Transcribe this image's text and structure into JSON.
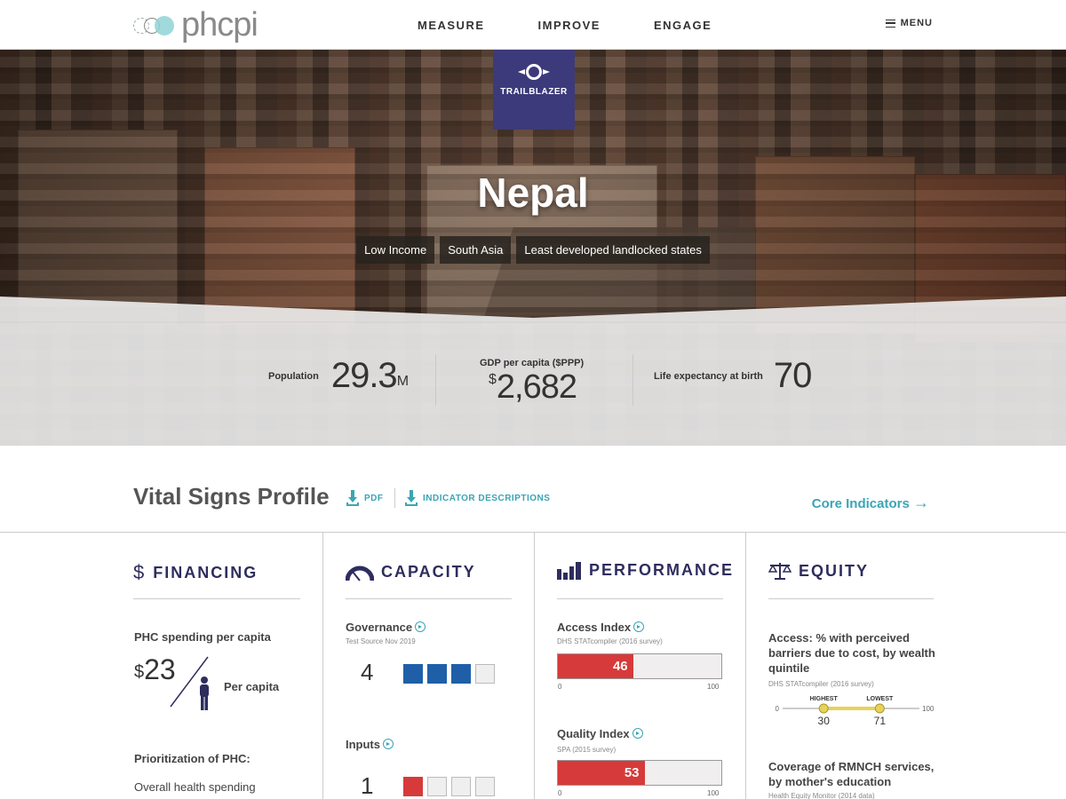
{
  "header": {
    "logo_text": "phcpi",
    "nav": [
      "MEASURE",
      "IMPROVE",
      "ENGAGE"
    ],
    "menu_label": "MENU"
  },
  "hero": {
    "badge": "TRAILBLAZER",
    "country": "Nepal",
    "tags": [
      "Low Income",
      "South Asia",
      "Least developed landlocked states"
    ]
  },
  "stats": {
    "population": {
      "label": "Population",
      "value": "29.3",
      "unit": "M"
    },
    "gdp": {
      "label": "GDP per capita ($PPP)",
      "currency": "$",
      "value": "2,682"
    },
    "life": {
      "label": "Life expectancy at birth",
      "value": "70"
    }
  },
  "profile": {
    "title": "Vital Signs Profile",
    "pdf_label": "PDF",
    "indicator_label": "INDICATOR DESCRIPTIONS",
    "core_link": "Core Indicators"
  },
  "financing": {
    "title": "FINANCING",
    "spending_label": "PHC spending per capita",
    "currency": "$",
    "spending_value": "23",
    "per_capita": "Per capita",
    "prioritization": "Prioritization of PHC:",
    "overall": "Overall health spending"
  },
  "capacity": {
    "title": "CAPACITY",
    "governance": {
      "label": "Governance",
      "source": "Test Source Nov 2019",
      "score": "4",
      "filled": 3
    },
    "inputs": {
      "label": "Inputs",
      "score": "1",
      "filled": 1
    }
  },
  "performance": {
    "title": "PERFORMANCE",
    "access": {
      "label": "Access Index",
      "source": "DHS STATcompiler (2016 survey)",
      "value": 46
    },
    "quality": {
      "label": "Quality Index",
      "source": "SPA (2015 survey)",
      "value": 53
    },
    "axis_min": "0",
    "axis_max": "100"
  },
  "equity": {
    "title": "EQUITY",
    "access_label": "Access: % with perceived barriers due to cost, by wealth quintile",
    "access_source": "DHS STATcompiler (2016 survey)",
    "highest_label": "HIGHEST",
    "lowest_label": "LOWEST",
    "highest_value": 30,
    "lowest_value": 71,
    "axis_min": "0",
    "axis_max": "100",
    "coverage_label": "Coverage of RMNCH services, by mother's education",
    "coverage_source": "Health Equity Monitor (2014 data)"
  },
  "colors": {
    "accent": "#3aa5b5",
    "navy": "#2e2d5e",
    "badge": "#3c3a7a",
    "red": "#d73a3a",
    "blue": "#1f5fa8"
  }
}
